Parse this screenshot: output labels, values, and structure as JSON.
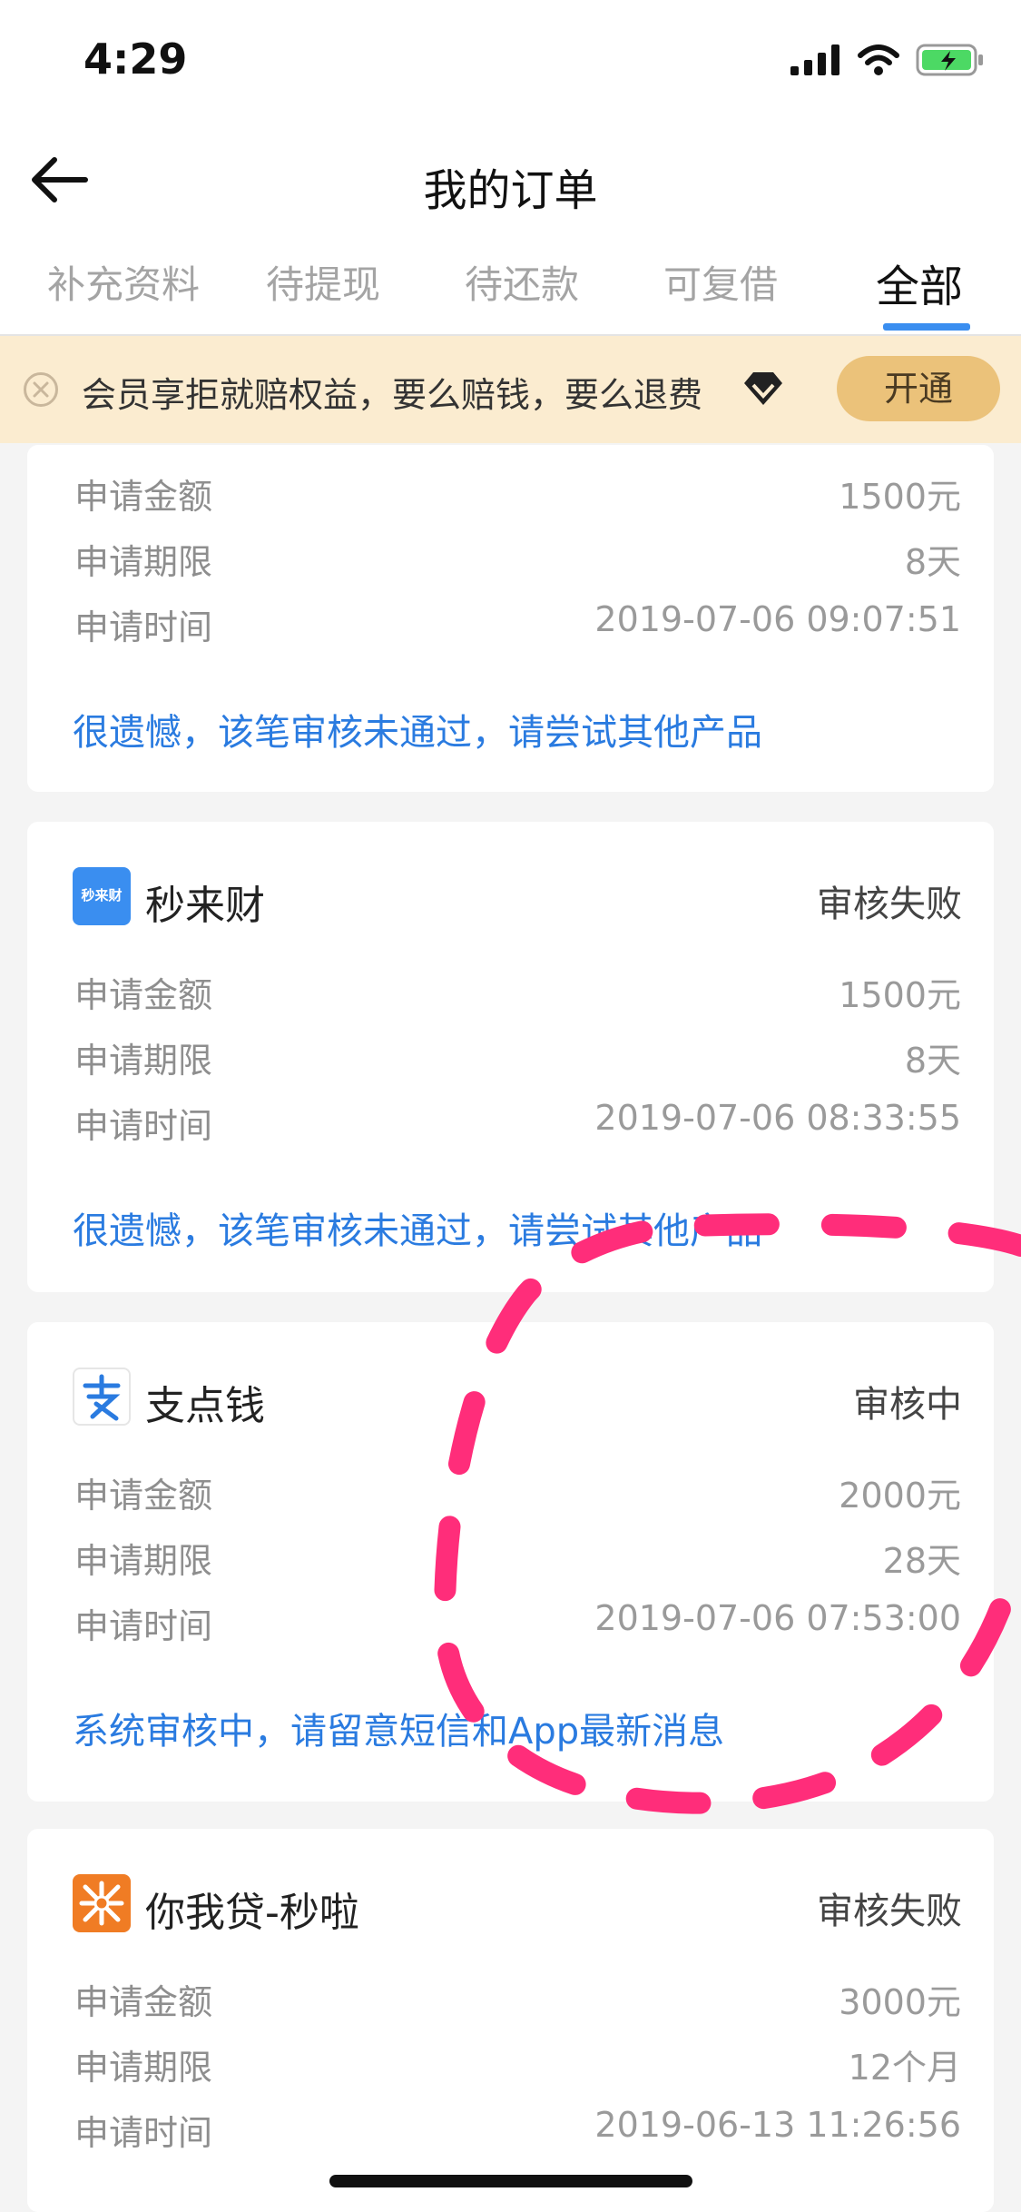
{
  "status_bar": {
    "time": "4:29"
  },
  "nav": {
    "title": "我的订单"
  },
  "tabs": [
    {
      "label": "补充资料"
    },
    {
      "label": "待提现"
    },
    {
      "label": "待还款"
    },
    {
      "label": "可复借"
    },
    {
      "label": "全部"
    }
  ],
  "active_tab": "全部",
  "banner": {
    "text": "会员享拒就赔权益，要么赔钱，要么退费",
    "button": "开通"
  },
  "orders": [
    {
      "amount_label": "申请金额",
      "amount": "1500元",
      "term_label": "申请期限",
      "term": "8天",
      "time_label": "申请时间",
      "time": "2019-07-06 09:07:51",
      "message": "很遗憾，该笔审核未通过，请尝试其他产品"
    },
    {
      "name": "秒来财",
      "logo_text": "秒来财",
      "status": "审核失败",
      "amount_label": "申请金额",
      "amount": "1500元",
      "term_label": "申请期限",
      "term": "8天",
      "time_label": "申请时间",
      "time": "2019-07-06 08:33:55",
      "message": "很遗憾，该笔审核未通过，请尝试其他产品"
    },
    {
      "name": "支点钱",
      "status": "审核中",
      "amount_label": "申请金额",
      "amount": "2000元",
      "term_label": "申请期限",
      "term": "28天",
      "time_label": "申请时间",
      "time": "2019-07-06 07:53:00",
      "message": "系统审核中，请留意短信和App最新消息"
    },
    {
      "name": "你我贷-秒啦",
      "status": "审核失败",
      "amount_label": "申请金额",
      "amount": "3000元",
      "term_label": "申请期限",
      "term": "12个月",
      "time_label": "申请时间",
      "time": "2019-06-13 11:26:56"
    }
  ],
  "colors": {
    "accent": "#3a8ef0",
    "link": "#2a7be0",
    "banner_bg": "#fbecd0",
    "banner_button": "#ebc27a",
    "scribble": "#ff2d7a"
  }
}
